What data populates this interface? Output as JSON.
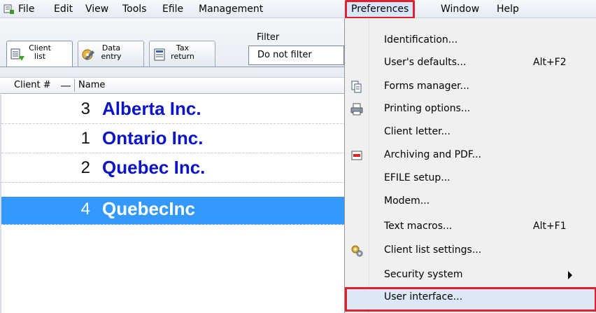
{
  "menubar": {
    "items": [
      "File",
      "Edit",
      "View",
      "Tools",
      "Efile",
      "Management",
      "Preferences",
      "Window",
      "Help"
    ]
  },
  "toolbar": {
    "buttons": [
      {
        "label": "Client\nlist",
        "icon": "client-list-icon"
      },
      {
        "label": "Data\nentry",
        "icon": "data-entry-icon"
      },
      {
        "label": "Tax\nreturn",
        "icon": "tax-return-icon"
      }
    ],
    "filter_label": "Filter",
    "filter_value": "Do not filter"
  },
  "list": {
    "columns": [
      "Client #",
      "Name"
    ],
    "rows": [
      {
        "num": "3",
        "name": "Alberta Inc.",
        "selected": false
      },
      {
        "num": "1",
        "name": "Ontario Inc.",
        "selected": false
      },
      {
        "num": "2",
        "name": "Quebec Inc.",
        "selected": false
      },
      {
        "num": "4",
        "name": "QuebecInc",
        "selected": true
      }
    ]
  },
  "preferences_menu": {
    "items": [
      {
        "label": "Identification...",
        "shortcut": "",
        "icon": ""
      },
      {
        "label": "User's defaults...",
        "shortcut": "Alt+F2",
        "icon": ""
      },
      {
        "label": "Forms manager...",
        "shortcut": "",
        "icon": "forms-manager-icon"
      },
      {
        "label": "Printing options...",
        "shortcut": "",
        "icon": "printer-icon"
      },
      {
        "label": "Client letter...",
        "shortcut": "",
        "icon": ""
      },
      {
        "label": "Archiving and PDF...",
        "shortcut": "",
        "icon": "pdf-icon"
      },
      {
        "label": "EFILE setup...",
        "shortcut": "",
        "icon": ""
      },
      {
        "label": "Modem...",
        "shortcut": "",
        "icon": ""
      },
      {
        "label": "Text macros...",
        "shortcut": "Alt+F1",
        "icon": ""
      },
      {
        "label": "Client list settings...",
        "shortcut": "",
        "icon": "gears-icon"
      },
      {
        "label": "Security system",
        "shortcut": "",
        "icon": "",
        "submenu": true
      },
      {
        "label": "User interface...",
        "shortcut": "",
        "icon": "",
        "highlighted": true
      }
    ]
  },
  "colors": {
    "highlight_border": "#e0202e",
    "selection": "#3399ff",
    "client_name": "#0a14c8"
  }
}
